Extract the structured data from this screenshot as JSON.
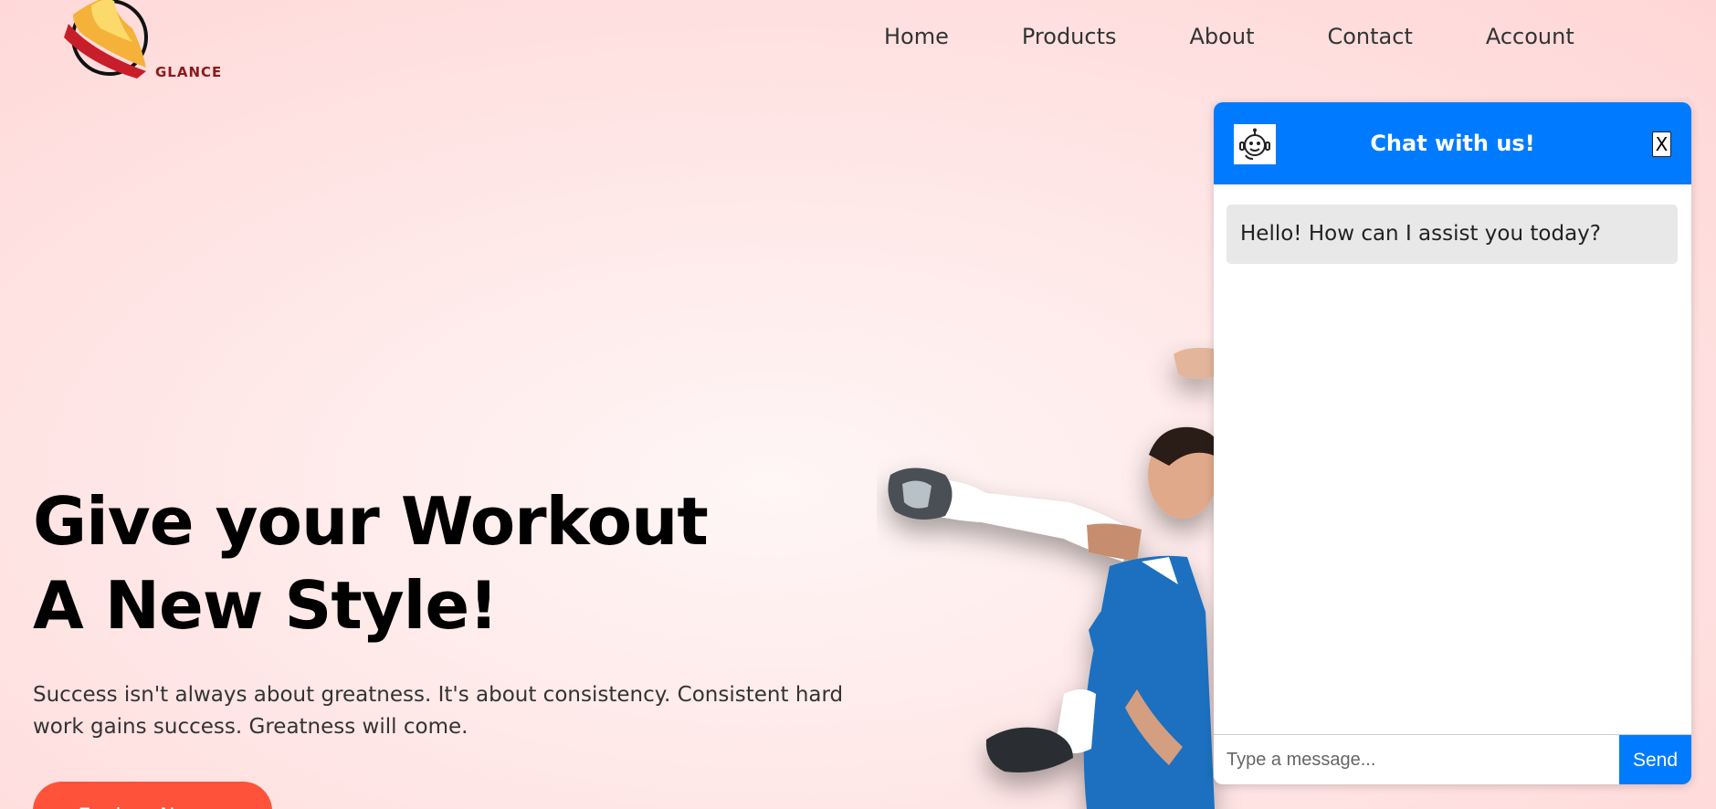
{
  "brand": {
    "name": "GLANCE",
    "logo_icon": "flame-shoe-logo"
  },
  "nav": {
    "items": [
      {
        "label": "Home"
      },
      {
        "label": "Products"
      },
      {
        "label": "About"
      },
      {
        "label": "Contact"
      },
      {
        "label": "Account"
      }
    ]
  },
  "hero": {
    "title_line1": "Give your Workout",
    "title_line2": "A New Style!",
    "subtitle": "Success isn't always about greatness. It's about consistency. Consistent hard work gains success. Greatness will come.",
    "button_label": "Explore Now →"
  },
  "chat": {
    "title": "Chat with us!",
    "close_label": "X",
    "avatar_icon": "robot-icon",
    "messages": [
      {
        "text": "Hello! How can I assist you today?"
      }
    ],
    "input_placeholder": "Type a message...",
    "input_value": "",
    "send_label": "Send"
  },
  "colors": {
    "accent": "#007bff",
    "cta": "#ff523b",
    "brand_text": "#8b1a1a"
  }
}
